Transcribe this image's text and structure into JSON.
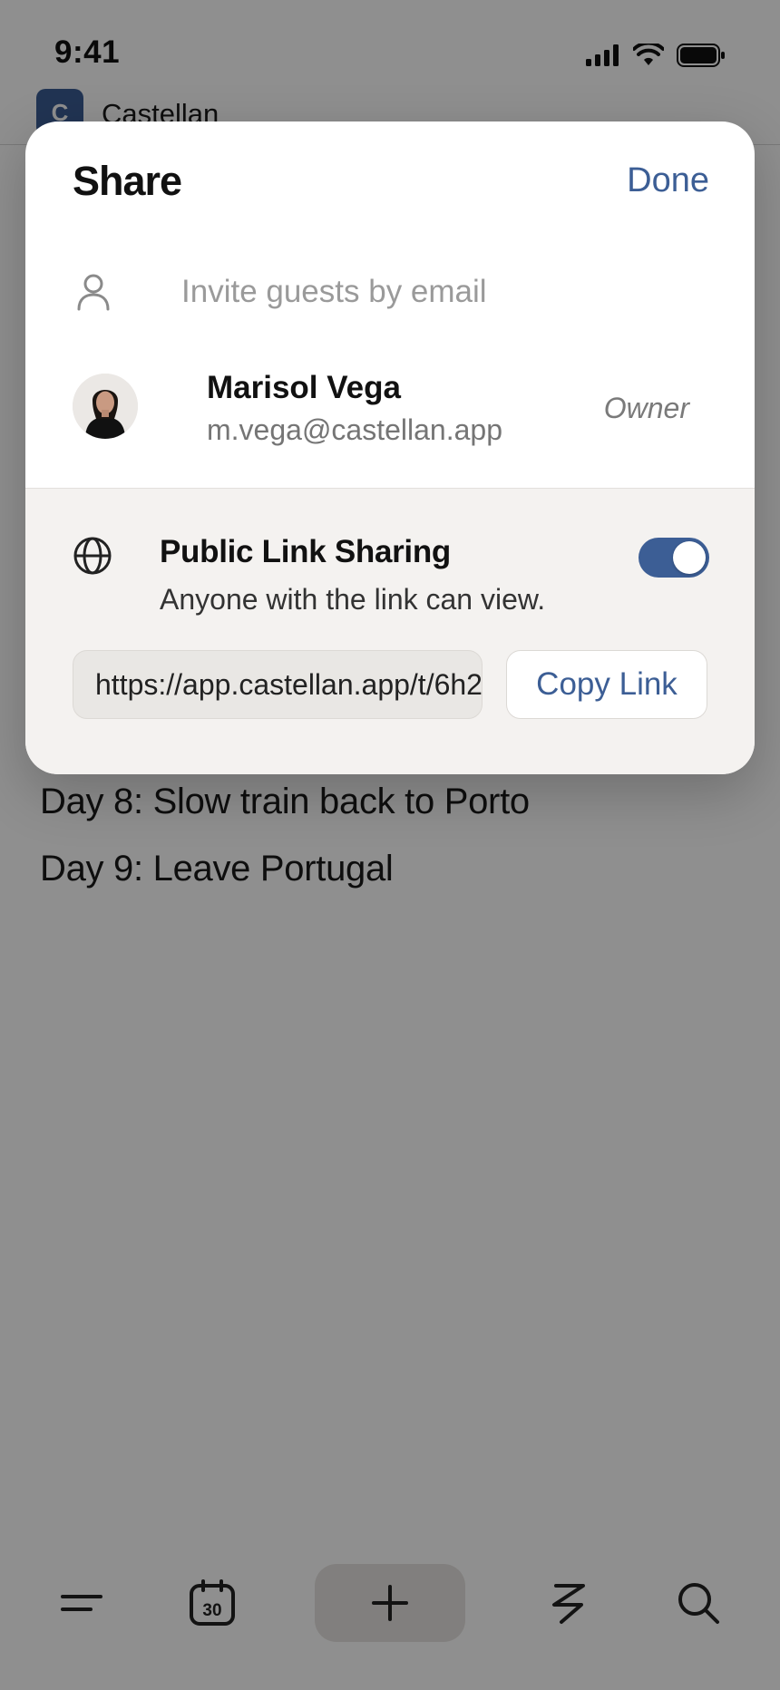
{
  "status_bar": {
    "time": "9:41",
    "icons": [
      "signal-icon",
      "wifi-icon",
      "battery-icon"
    ]
  },
  "app": {
    "logo_letter": "C",
    "name": "Castellan",
    "itinerary": [
      "Day 8: Slow train back to Porto",
      "Day 9: Leave Portugal"
    ],
    "tabs": [
      {
        "name": "menu",
        "icon": "menu-icon"
      },
      {
        "name": "calendar",
        "icon": "calendar-icon",
        "label": "30"
      },
      {
        "name": "add",
        "icon": "plus-icon"
      },
      {
        "name": "activity",
        "icon": "zigzag-icon"
      },
      {
        "name": "search",
        "icon": "search-icon"
      }
    ]
  },
  "share_sheet": {
    "title": "Share",
    "done_label": "Done",
    "invite_placeholder": "Invite guests by email",
    "member": {
      "name": "Marisol Vega",
      "email": "m.vega@castellan.app",
      "role": "Owner"
    },
    "public_link": {
      "title": "Public Link Sharing",
      "subtitle": "Anyone with the link can view.",
      "enabled": true,
      "url": "https://app.castellan.app/t/6h2",
      "copy_label": "Copy Link"
    }
  },
  "colors": {
    "accent": "#3c5e95",
    "scrim": "rgba(0,0,0,0.44)",
    "sheet_background": "#ffffff",
    "section_background": "#f4f2f0"
  }
}
